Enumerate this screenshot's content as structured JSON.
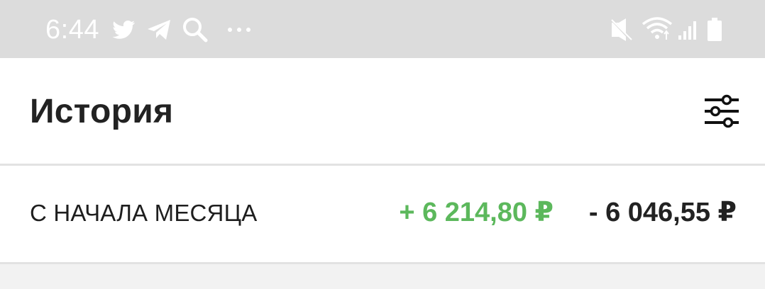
{
  "status_bar": {
    "time": "6:44",
    "notification_icons": [
      "twitter-icon",
      "telegram-icon",
      "search-icon",
      "more-dots-icon"
    ],
    "system_icons": [
      "vibrate-icon",
      "wifi-icon",
      "signal-icon",
      "battery-icon"
    ]
  },
  "header": {
    "title": "История",
    "filter_icon": "filter-sliders-icon"
  },
  "summary": {
    "period_label": "С НАЧАЛА МЕСЯЦА",
    "income": "+ 6 214,80 ₽",
    "expense": "- 6 046,55 ₽"
  },
  "colors": {
    "income": "#5cb85c",
    "status_bar_bg": "#dcdcdc"
  }
}
